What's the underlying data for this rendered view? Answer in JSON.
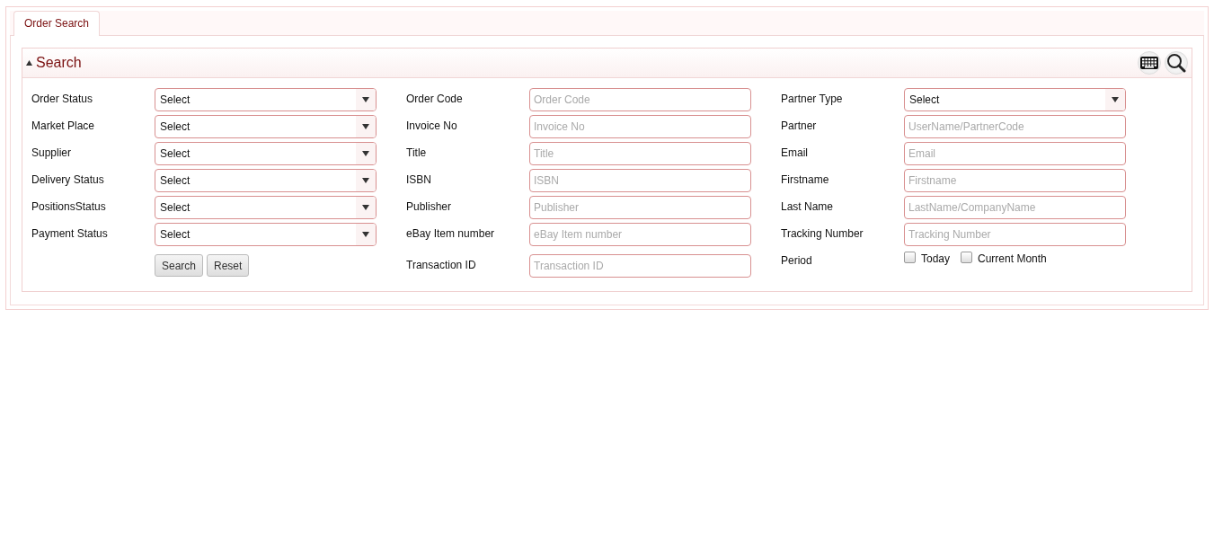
{
  "tabs": [
    {
      "label": "Order Search",
      "selected": true
    }
  ],
  "panel": {
    "title": "Search",
    "expanded": true
  },
  "columns": [
    {
      "fields": [
        {
          "kind": "select",
          "label": "Order Status",
          "value": "Select"
        },
        {
          "kind": "select",
          "label": "Market Place",
          "value": "Select"
        },
        {
          "kind": "select",
          "label": "Supplier",
          "value": "Select"
        },
        {
          "kind": "select",
          "label": "Delivery Status",
          "value": "Select"
        },
        {
          "kind": "select",
          "label": "PositionsStatus",
          "value": "Select"
        },
        {
          "kind": "select",
          "label": "Payment Status",
          "value": "Select"
        }
      ]
    },
    {
      "fields": [
        {
          "kind": "text",
          "label": "Order Code",
          "placeholder": "Order Code"
        },
        {
          "kind": "text",
          "label": "Invoice No",
          "placeholder": "Invoice No"
        },
        {
          "kind": "text",
          "label": "Title",
          "placeholder": "Title"
        },
        {
          "kind": "text",
          "label": "ISBN",
          "placeholder": "ISBN"
        },
        {
          "kind": "text",
          "label": "Publisher",
          "placeholder": "Publisher"
        },
        {
          "kind": "text",
          "label": "eBay Item number",
          "placeholder": "eBay Item number"
        },
        {
          "kind": "text",
          "label": "Transaction ID",
          "placeholder": "Transaction ID"
        }
      ]
    },
    {
      "fields": [
        {
          "kind": "select",
          "label": "Partner Type",
          "value": "Select"
        },
        {
          "kind": "text",
          "label": "Partner",
          "placeholder": "UserName/PartnerCode"
        },
        {
          "kind": "text",
          "label": "Email",
          "placeholder": "Email"
        },
        {
          "kind": "text",
          "label": "Firstname",
          "placeholder": "Firstname"
        },
        {
          "kind": "text",
          "label": "Last Name",
          "placeholder": "LastName/CompanyName"
        },
        {
          "kind": "text",
          "label": "Tracking Number",
          "placeholder": "Tracking Number"
        },
        {
          "kind": "checks",
          "label": "Period",
          "options": [
            {
              "label": "Today",
              "checked": false
            },
            {
              "label": "Current Month",
              "checked": false
            }
          ]
        }
      ]
    }
  ],
  "buttons": [
    "Search",
    "Reset"
  ]
}
